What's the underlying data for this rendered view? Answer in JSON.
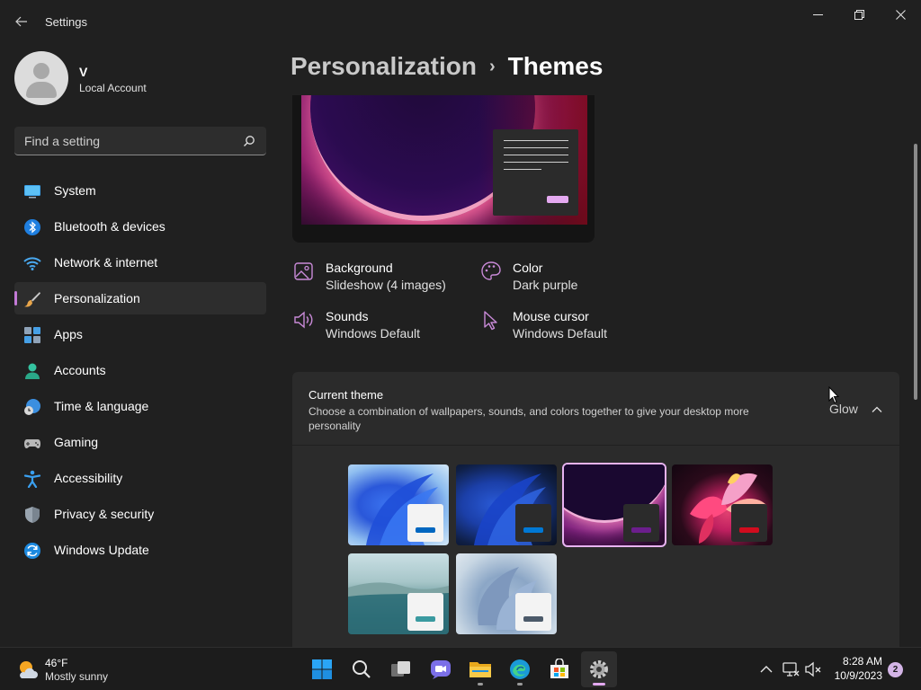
{
  "window": {
    "title": "Settings",
    "back_icon": "arrow-left-icon",
    "controls": [
      "minimize-icon",
      "maximize-icon",
      "close-icon"
    ]
  },
  "profile": {
    "name": "V",
    "account_type": "Local Account"
  },
  "search": {
    "placeholder": "Find a setting"
  },
  "sidebar": {
    "items": [
      {
        "label": "System",
        "icon": "monitor-icon"
      },
      {
        "label": "Bluetooth & devices",
        "icon": "bluetooth-icon"
      },
      {
        "label": "Network & internet",
        "icon": "wifi-icon"
      },
      {
        "label": "Personalization",
        "icon": "brush-icon",
        "selected": true
      },
      {
        "label": "Apps",
        "icon": "apps-icon"
      },
      {
        "label": "Accounts",
        "icon": "person-icon"
      },
      {
        "label": "Time & language",
        "icon": "globe-clock-icon"
      },
      {
        "label": "Gaming",
        "icon": "gamepad-icon"
      },
      {
        "label": "Accessibility",
        "icon": "accessibility-icon"
      },
      {
        "label": "Privacy & security",
        "icon": "shield-icon"
      },
      {
        "label": "Windows Update",
        "icon": "refresh-icon"
      }
    ]
  },
  "breadcrumb": {
    "parent": "Personalization",
    "separator": "›",
    "current": "Themes"
  },
  "properties": {
    "background": {
      "title": "Background",
      "value": "Slideshow (4 images)"
    },
    "color": {
      "title": "Color",
      "value": "Dark purple"
    },
    "sounds": {
      "title": "Sounds",
      "value": "Windows Default"
    },
    "cursor": {
      "title": "Mouse cursor",
      "value": "Windows Default"
    }
  },
  "current_theme": {
    "title": "Current theme",
    "description": "Choose a combination of wallpapers, sounds, and colors together to give your desktop more personality",
    "selected": "Glow",
    "themes": [
      {
        "id": "windows-light",
        "accent": "#0067c0"
      },
      {
        "id": "windows-dark",
        "accent": "#0078d4"
      },
      {
        "id": "glow",
        "accent": "#6b1e8c",
        "selected": true
      },
      {
        "id": "captured-motion",
        "accent": "#d10c1e"
      },
      {
        "id": "sunrise",
        "accent": "#3a9aa0"
      },
      {
        "id": "flow",
        "accent": "#4c5a6a"
      }
    ]
  },
  "colors": {
    "accent": "#c37ad6",
    "window_bg": "#202020",
    "card_bg": "#2b2b2b"
  },
  "taskbar": {
    "weather": {
      "temp": "46°F",
      "condition": "Mostly sunny"
    },
    "apps": [
      "start-icon",
      "search-icon",
      "task-view-icon",
      "chat-icon",
      "file-explorer-icon",
      "edge-icon",
      "store-icon",
      "settings-icon"
    ],
    "clock": {
      "time": "8:28 AM",
      "date": "10/9/2023"
    },
    "notification_count": "2"
  }
}
